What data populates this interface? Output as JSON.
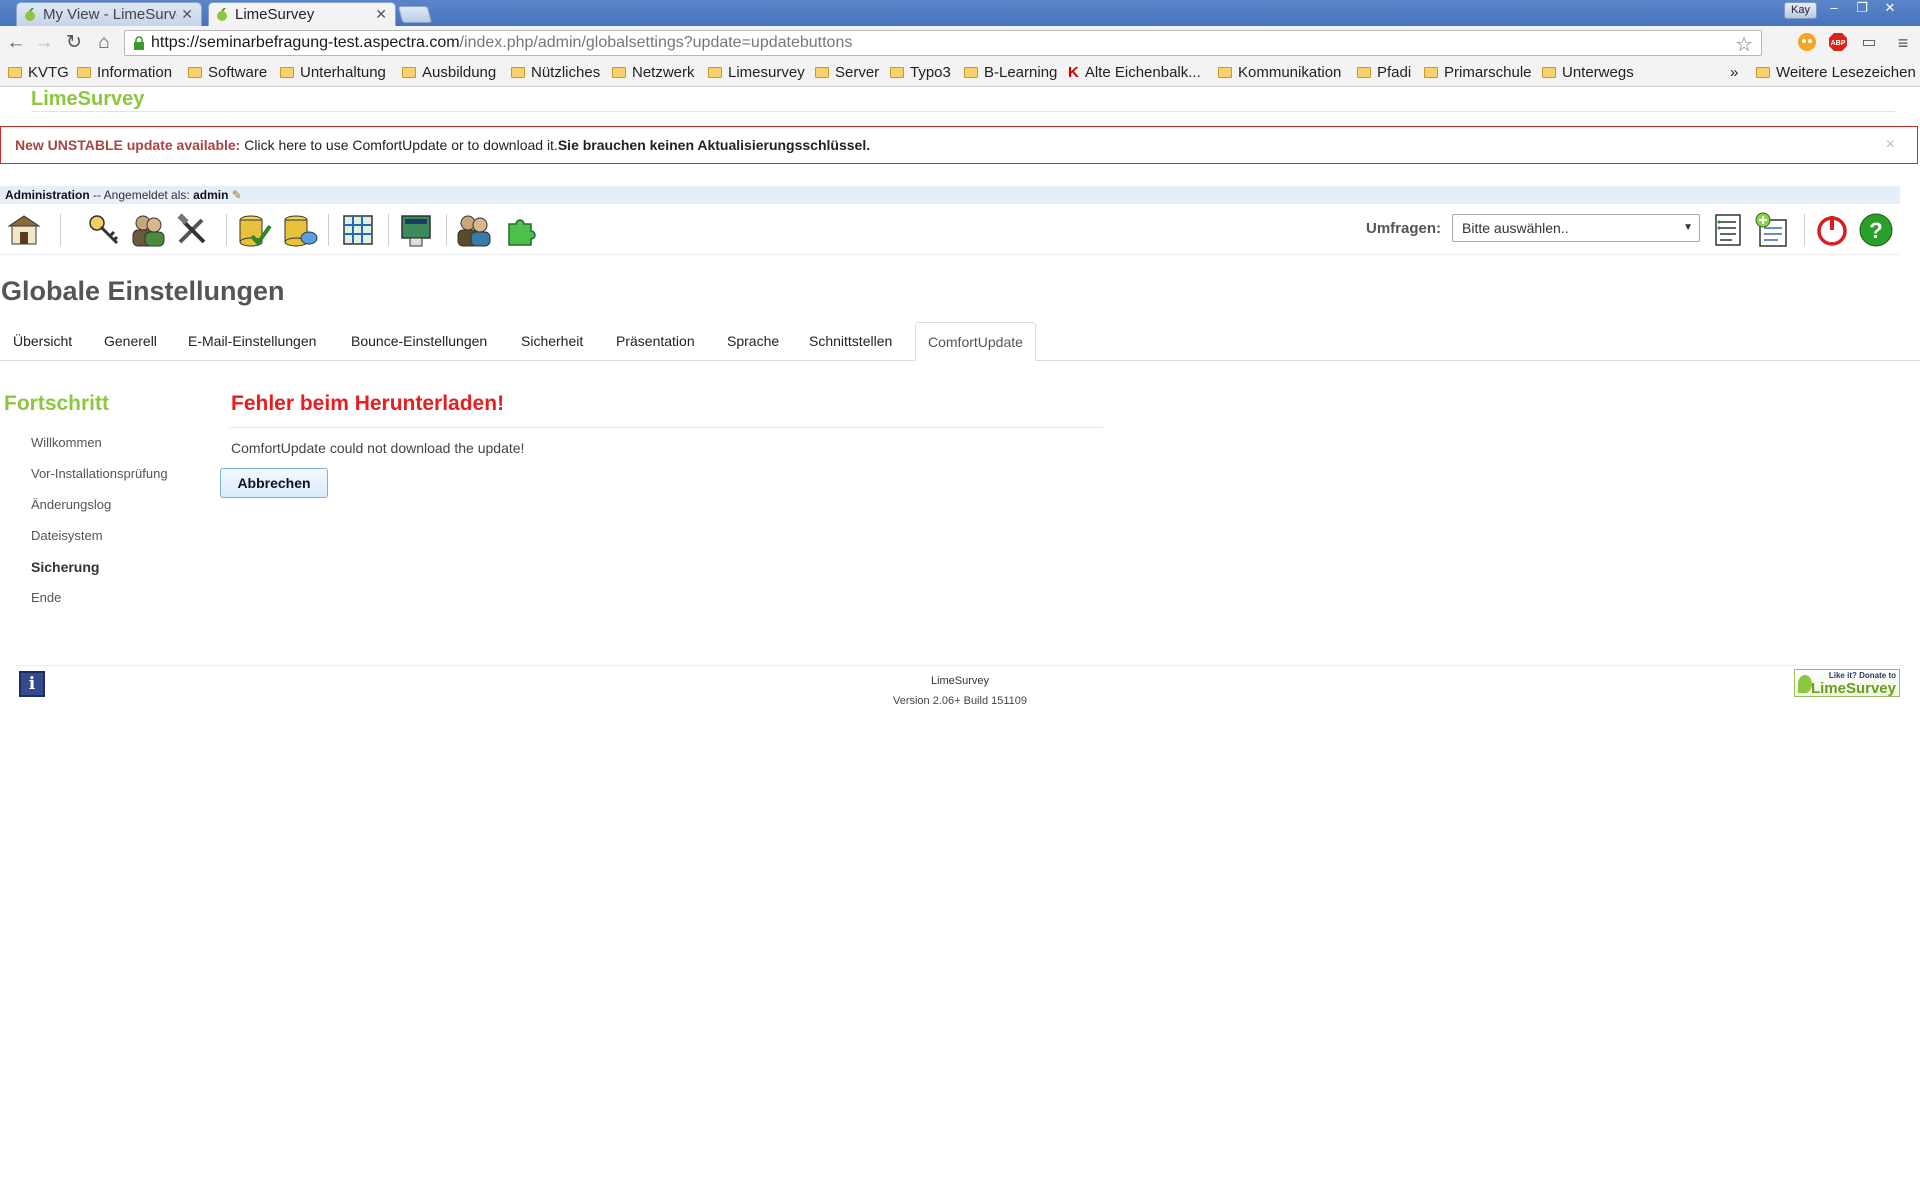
{
  "browser": {
    "tabs": [
      {
        "label": "My View - LimeSurve",
        "active": false
      },
      {
        "label": "LimeSurvey",
        "active": true
      }
    ],
    "user": "Kay",
    "url_main": "https://seminarbefragung-test.aspectra.com",
    "url_rest": "/index.php/admin/globalsettings?update=updatebuttons",
    "extension_abp": "ABP",
    "bookmarks_overflow": "»",
    "bookmarks": [
      "KVTG",
      "Information",
      "Software",
      "Unterhaltung",
      "Ausbildung",
      "Nützliches",
      "Netzwerk",
      "Limesurvey",
      "Server",
      "Typo3",
      "B-Learning",
      "Alte Eichenbalk...",
      "Kommunikation",
      "Pfadi",
      "Primarschule",
      "Unterwegs"
    ],
    "other_bookmarks": "Weitere Lesezeichen"
  },
  "app": {
    "brand": "LimeSurvey",
    "accent_color": "#8dc63f"
  },
  "alert": {
    "warning": "New UNSTABLE update available:",
    "text": " Click here to use ComfortUpdate or to download it.",
    "bold": "Sie brauchen keinen Aktualisierungsschlüssel.",
    "close": "×"
  },
  "adminbar": {
    "title": "Administration",
    "separator": " -- Angemeldet als: ",
    "user": "admin"
  },
  "toolbar": {
    "umfragen_label": "Umfragen:",
    "survey_select_value": "Bitte auswählen.."
  },
  "page": {
    "title": "Globale Einstellungen",
    "tabs": [
      "Übersicht",
      "Generell",
      "E-Mail-Einstellungen",
      "Bounce-Einstellungen",
      "Sicherheit",
      "Präsentation",
      "Sprache",
      "Schnittstellen",
      "ComfortUpdate"
    ],
    "active_tab": "ComfortUpdate"
  },
  "progress": {
    "title": "Fortschritt",
    "steps": [
      "Willkommen",
      "Vor-Installationsprüfung",
      "Änderungslog",
      "Dateisystem",
      "Sicherung",
      "Ende"
    ],
    "current_step": "Sicherung"
  },
  "error": {
    "title": "Fehler beim Herunterladen!",
    "message": "ComfortUpdate could not download the update!",
    "cancel_label": "Abbrechen"
  },
  "footer": {
    "name": "LimeSurvey",
    "version": "Version 2.06+ Build 151109",
    "donate_small": "Like it? Donate to",
    "donate_big": "LimeSurvey"
  }
}
